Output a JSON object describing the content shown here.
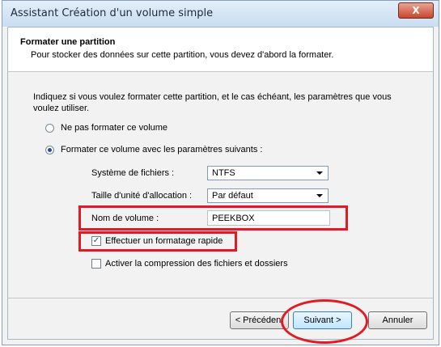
{
  "window": {
    "title": "Assistant Création d'un volume simple",
    "close_glyph": "X"
  },
  "header": {
    "title": "Formater une partition",
    "subtitle": "Pour stocker des données sur cette partition, vous devez d'abord la formater."
  },
  "content": {
    "intro": "Indiquez si vous voulez formater cette partition, et le cas échéant, les paramètres que vous voulez utiliser.",
    "radio_no_format": {
      "label": "Ne pas formater ce volume",
      "selected": false
    },
    "radio_format": {
      "label": "Formater ce volume avec les paramètres suivants :",
      "selected": true
    },
    "filesystem": {
      "label": "Système de fichiers :",
      "value": "NTFS"
    },
    "allocation": {
      "label": "Taille d'unité d'allocation :",
      "value": "Par défaut"
    },
    "volume_name": {
      "label": "Nom de volume :",
      "value": "PEEKBOX"
    },
    "quick_format": {
      "label": "Effectuer un formatage rapide",
      "checked": true,
      "glyph": "✓"
    },
    "compression": {
      "label": "Activer la compression des fichiers et dossiers",
      "checked": false
    }
  },
  "buttons": {
    "back": "< Précédent",
    "next": "Suivant >",
    "cancel": "Annuler"
  },
  "colors": {
    "highlight": "#e01b24",
    "titlebar": "#c9ddf1"
  }
}
